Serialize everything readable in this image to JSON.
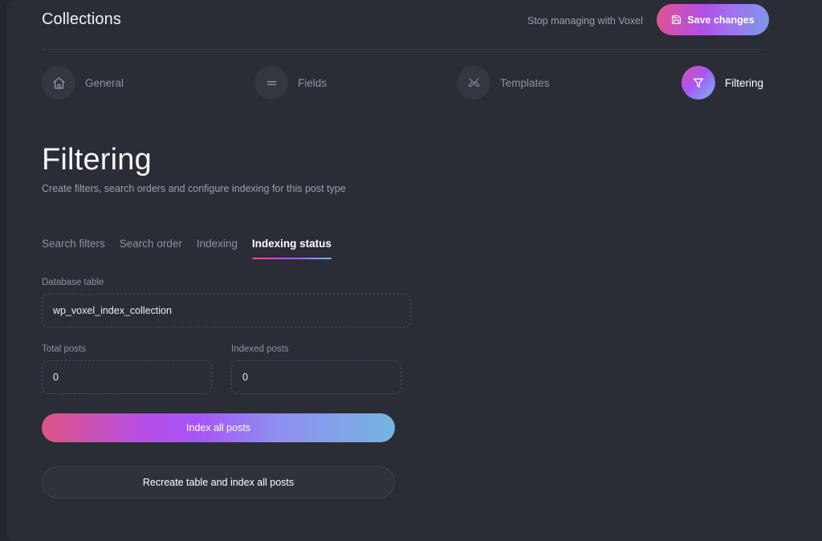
{
  "topbar": {
    "app_title": "Collections",
    "stop_managing_label": "Stop managing with Voxel",
    "save_label": "Save changes",
    "save_icon": "floppy-disk-icon"
  },
  "section_tabs": [
    {
      "label": "General",
      "icon": "home-icon",
      "active": false
    },
    {
      "label": "Fields",
      "icon": "equals-icon",
      "active": false
    },
    {
      "label": "Templates",
      "icon": "design-tools-icon",
      "active": false
    },
    {
      "label": "Filtering",
      "icon": "funnel-icon",
      "active": true
    }
  ],
  "page": {
    "title": "Filtering",
    "subtitle": "Create filters, search orders and configure indexing for this post type"
  },
  "sub_tabs": [
    {
      "label": "Search filters",
      "active": false
    },
    {
      "label": "Search order",
      "active": false
    },
    {
      "label": "Indexing",
      "active": false
    },
    {
      "label": "Indexing status",
      "active": true
    }
  ],
  "form": {
    "database_table": {
      "label": "Database table",
      "value": "wp_voxel_index_collection",
      "placeholder": "Database table"
    },
    "total_posts": {
      "label": "Total posts",
      "value": "0",
      "placeholder": "0"
    },
    "indexed_posts": {
      "label": "Indexed posts",
      "value": "0",
      "placeholder": "0"
    },
    "index_all_label": "Index all posts",
    "recreate_label": "Recreate table and index all posts"
  },
  "colors": {
    "background": "#2a2d35",
    "shell": "#23262c",
    "accent_pink": "#e0548f",
    "accent_purple": "#a855f7",
    "accent_blue": "#74b6e0",
    "text_primary": "#f2f3f5",
    "text_muted": "#8d939d"
  }
}
